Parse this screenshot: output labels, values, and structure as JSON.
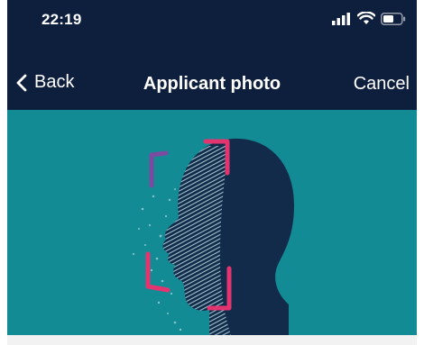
{
  "status_bar": {
    "time": "22:19",
    "icons": [
      "signal-icon",
      "wifi-icon",
      "battery-icon"
    ]
  },
  "nav": {
    "back_label": "Back",
    "title": "Applicant photo",
    "cancel_label": "Cancel"
  },
  "illustration": {
    "subject": "face-scan-illustration",
    "icon": "face-scan-icon"
  },
  "colors": {
    "header_bg": "#0e1e3d",
    "content_bg": "#138b95",
    "head_fill": "#132b4b",
    "scan_lines": "#b6dfe3",
    "frame_accent": "#e3346f",
    "frame_purple": "#7a4ba0"
  }
}
